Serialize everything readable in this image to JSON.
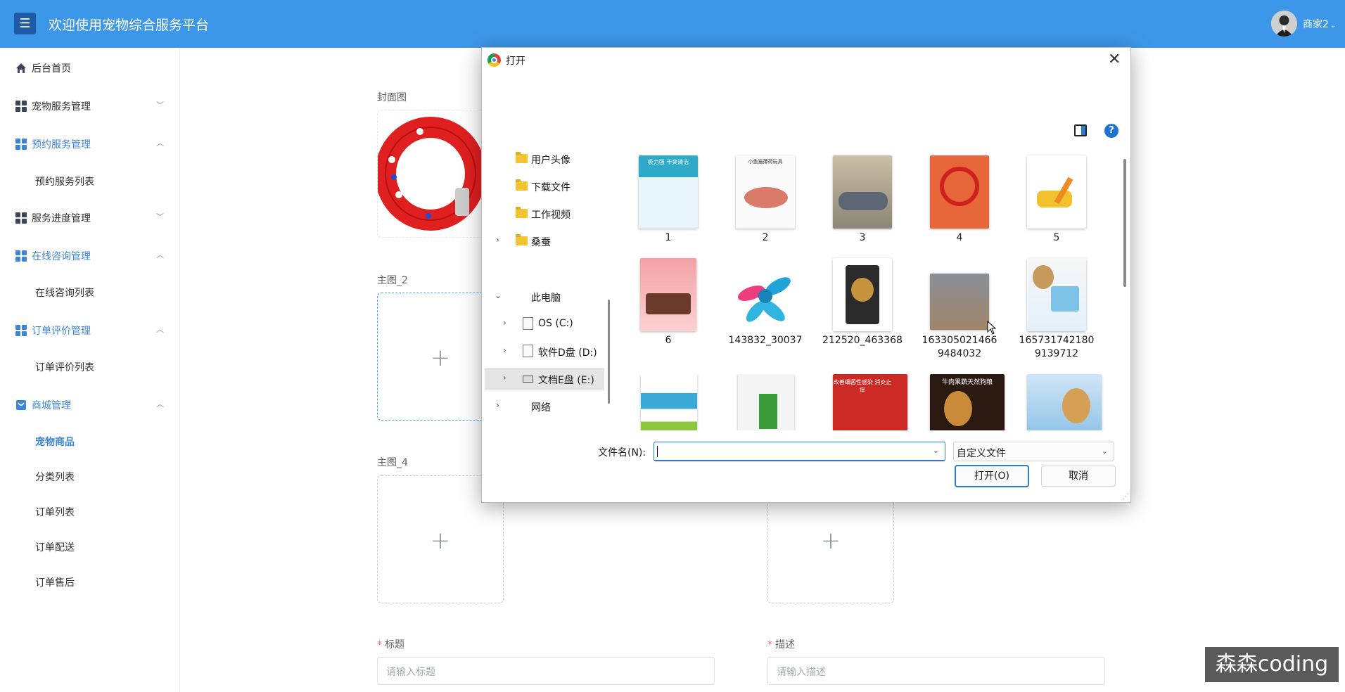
{
  "header": {
    "menu_icon": "hamburger-icon",
    "title": "欢迎使用宠物综合服务平台",
    "user": "商家2",
    "user_dropdown": "⌄"
  },
  "sidebar": {
    "home": "后台首页",
    "pet_service": "宠物服务管理",
    "booking": "预约服务管理",
    "booking_list": "预约服务列表",
    "progress": "服务进度管理",
    "consult": "在线咨询管理",
    "consult_list": "在线咨询列表",
    "review": "订单评价管理",
    "review_list": "订单评价列表",
    "mall": "商城管理",
    "pet_goods": "宠物商品",
    "category_list": "分类列表",
    "order_list": "订单列表",
    "order_delivery": "订单配送",
    "order_after_sales": "订单售后"
  },
  "form": {
    "cover_label": "封面图",
    "main2_label": "主图_2",
    "main4_label": "主图_4",
    "plus": "+",
    "title_label": "标题",
    "title_placeholder": "请输入标题",
    "desc_label": "描述",
    "desc_placeholder": "请输入描述",
    "required_mark": "*"
  },
  "dialog": {
    "title": "打开",
    "close": "✕",
    "help": "?",
    "nav": {
      "avatar": "用户头像",
      "downloads": "下载文件",
      "work_video": "工作视频",
      "silkworm": "桑蚕",
      "this_pc": "此电脑",
      "c": "OS (C:)",
      "d": "软件D盘 (D:)",
      "e": "文档E盘 (E:)",
      "network": "网络"
    },
    "files": [
      "1",
      "2",
      "3",
      "4",
      "5",
      "6",
      "143832_30037",
      "212520_463368",
      "163305021466\n9484032",
      "165731742180\n9139712"
    ],
    "thumb_texts": [
      "吸力强 干爽清洁",
      "小鱼猫薄荷玩具",
      "",
      "",
      "",
      "",
      "",
      "",
      "",
      "",
      "",
      "",
      "改善细菌性感染 消炎止痒",
      "牛肉果蔬天然狗粮",
      ""
    ],
    "filename_label": "文件名(N):",
    "filename_value": "",
    "filetype": "自定义文件",
    "open_btn": "打开(O)",
    "cancel_btn": "取消"
  },
  "watermark": "森森coding"
}
